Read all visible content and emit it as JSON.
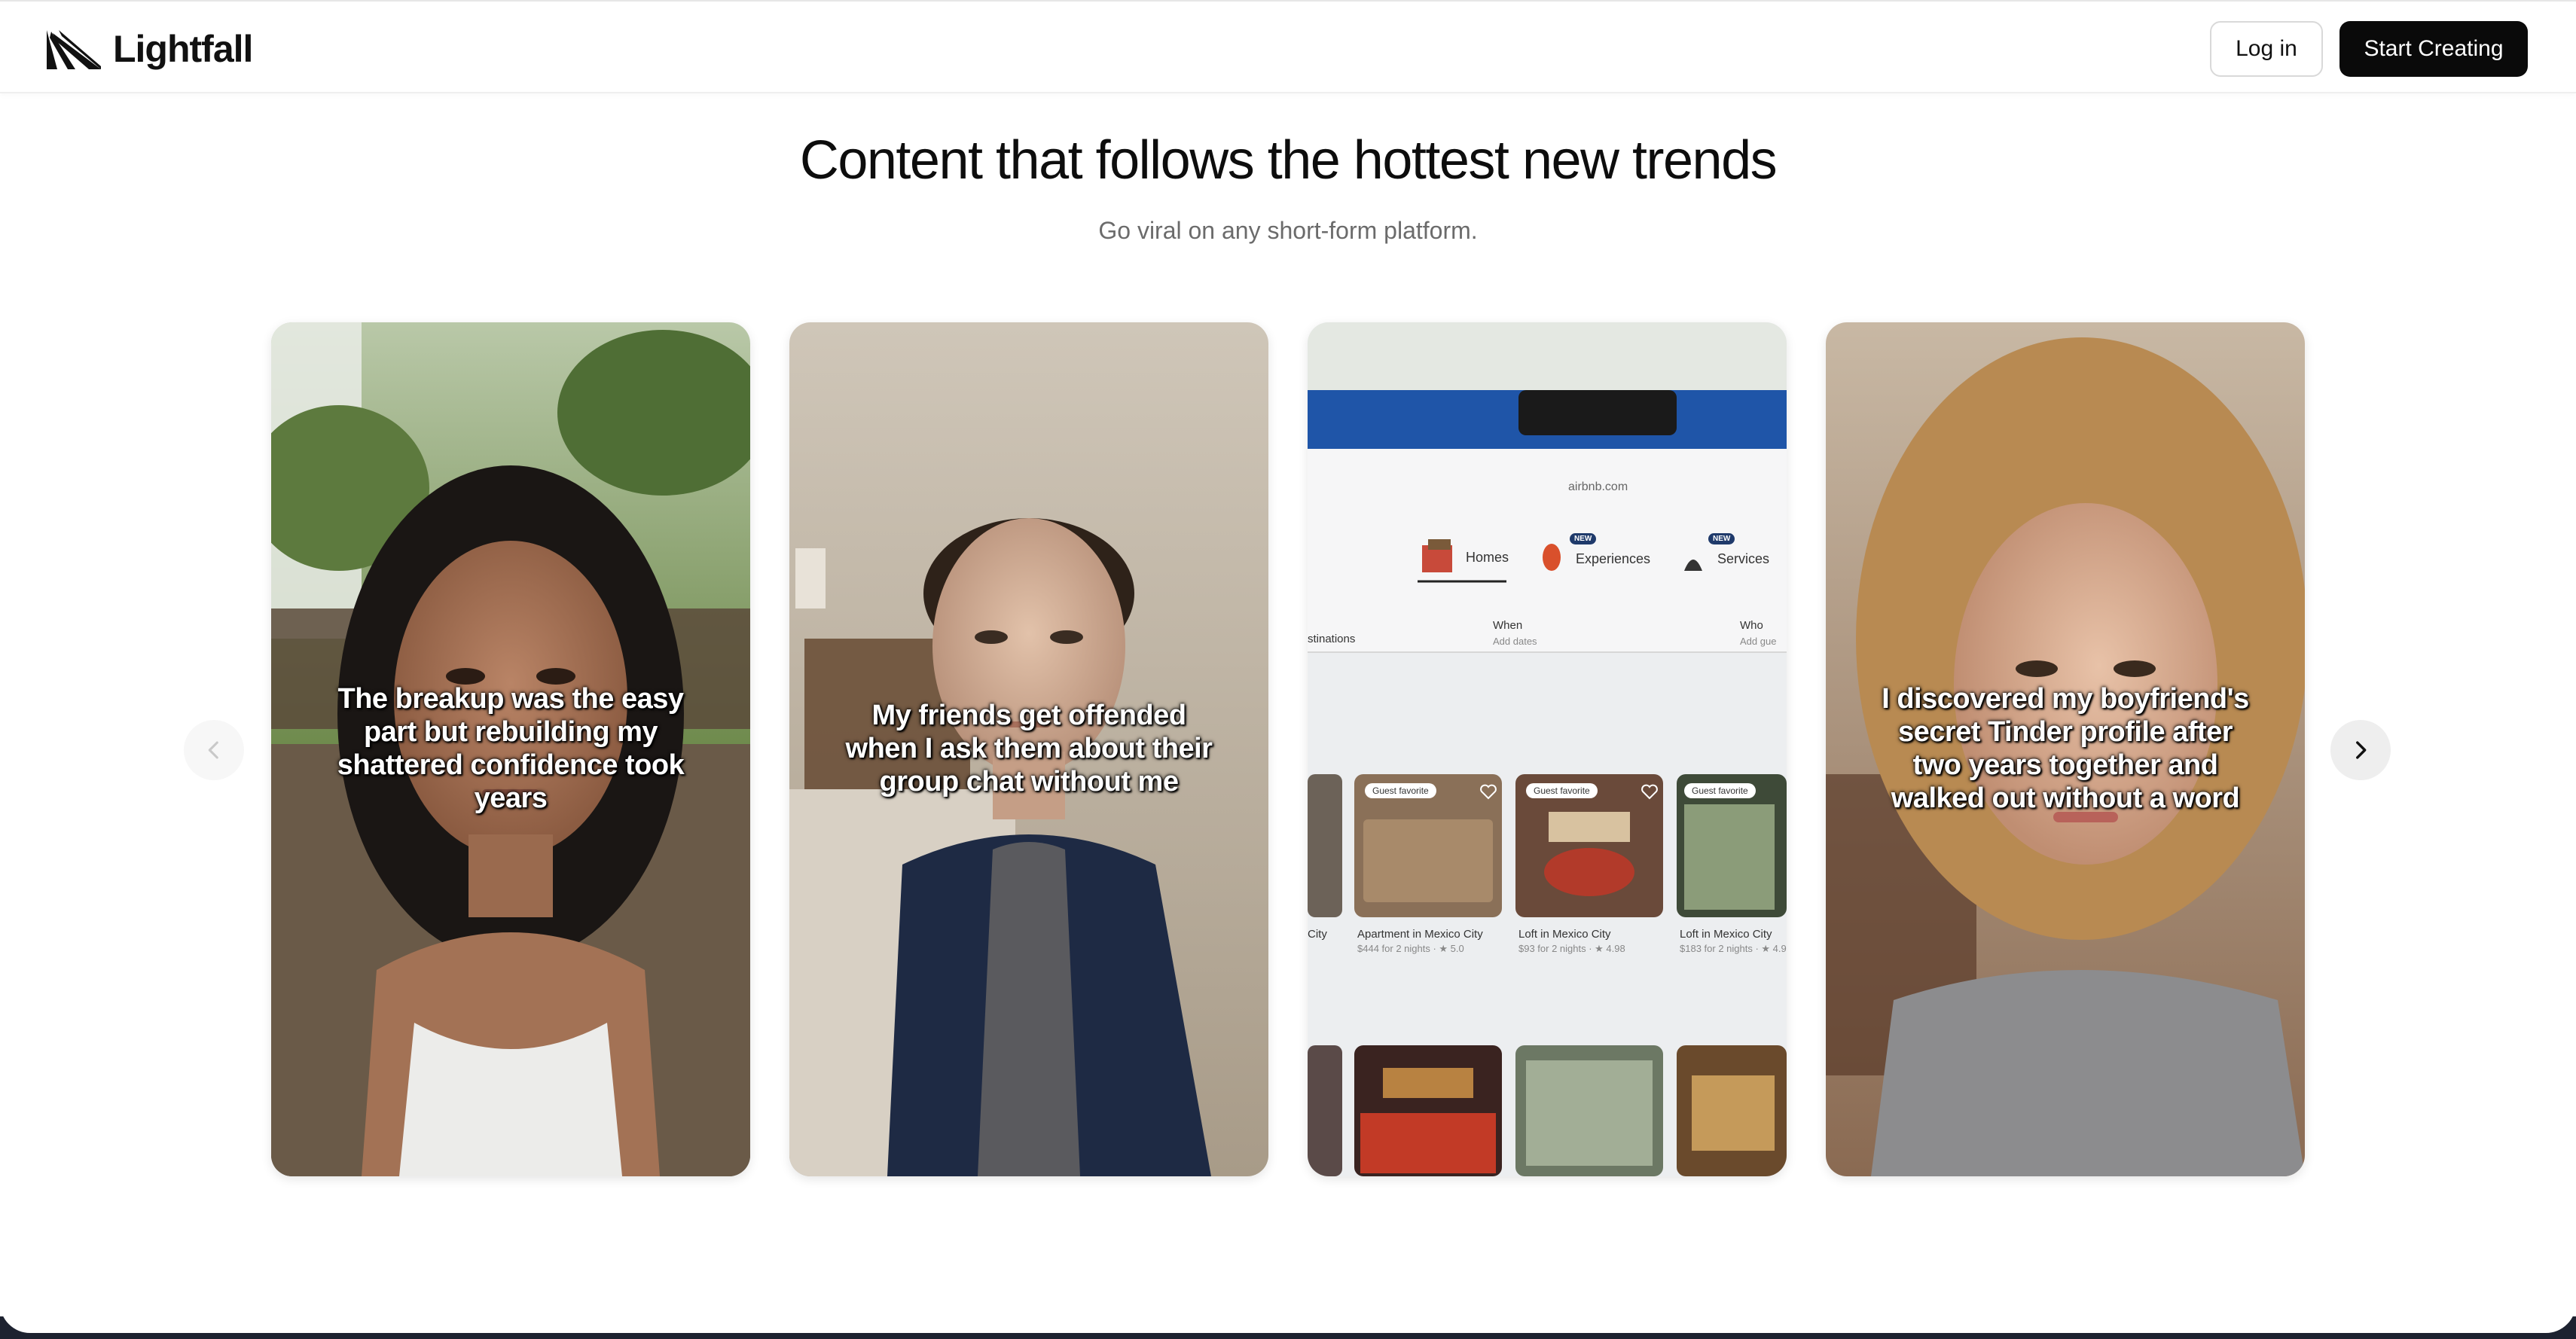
{
  "brand": {
    "name": "Lightfall",
    "logo_icon": "lightfall-logo-icon"
  },
  "header": {
    "login_label": "Log in",
    "start_label": "Start Creating"
  },
  "hero": {
    "title": "Content that follows the hottest new trends",
    "subtitle": "Go viral on any short-form platform."
  },
  "carousel": {
    "prev_icon": "chevron-left-icon",
    "next_icon": "chevron-right-icon",
    "cards": [
      {
        "caption": "The breakup was the easy part but rebuilding my shattered confidence took years"
      },
      {
        "caption": "My friends get offended when I ask them about their group chat without me"
      },
      {
        "caption": "",
        "screen": {
          "url": "airbnb.com",
          "tabs": [
            "Homes",
            "Experiences",
            "Services"
          ],
          "new_badge": "NEW",
          "search": {
            "where_label": "stinations",
            "when_label": "When",
            "when_value": "Add dates",
            "who_label": "Who",
            "who_value": "Add gue"
          },
          "listing_badge": "Guest favorite",
          "listings": [
            {
              "title": "City",
              "price": ""
            },
            {
              "title": "Apartment in Mexico City",
              "price": "$444 for 2 nights · ★ 5.0"
            },
            {
              "title": "Loft in Mexico City",
              "price": "$93 for 2 nights · ★ 4.98"
            },
            {
              "title": "Loft in Mexico City",
              "price": "$183 for 2 nights · ★ 4.9"
            }
          ]
        }
      },
      {
        "caption": "I discovered my boyfriend's secret Tinder profile after two years together and walked out without a word"
      }
    ]
  },
  "colors": {
    "primary_button": "#0a0a0a",
    "title_text": "#0d0d0d",
    "subtitle_text": "#6b6b6b"
  }
}
